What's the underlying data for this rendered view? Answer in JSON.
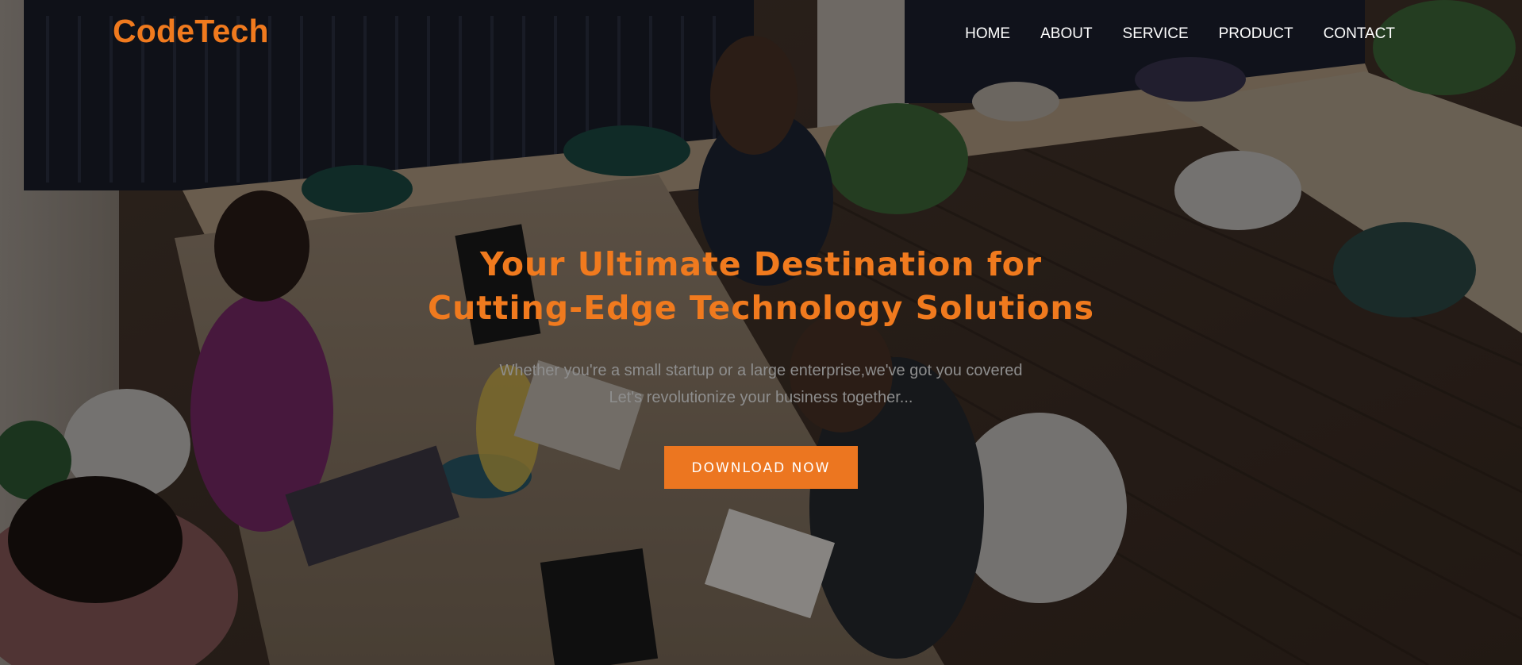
{
  "brand": {
    "name": "CodeTech",
    "accent_color": "#f07a1e"
  },
  "nav": {
    "items": [
      {
        "label": "HOME"
      },
      {
        "label": "ABOUT"
      },
      {
        "label": "SERVICE"
      },
      {
        "label": "PRODUCT"
      },
      {
        "label": "CONTACT"
      }
    ]
  },
  "hero": {
    "headline_line1": "Your Ultimate Destination for",
    "headline_line2": "Cutting-Edge Technology Solutions",
    "subtext_line1": "Whether you're a small startup or a large enterprise,we've got you covered",
    "subtext_line2": "Let's revolutionize your business together...",
    "cta_label": "DOWNLOAD NOW",
    "background_image": "office-coworking-photo"
  }
}
